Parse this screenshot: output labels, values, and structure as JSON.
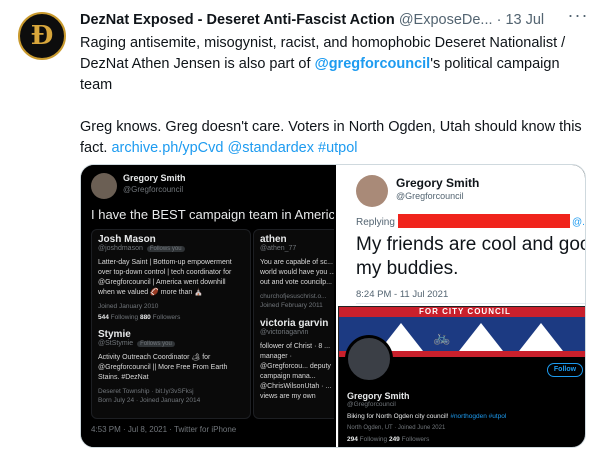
{
  "tweet": {
    "author_name": "DezNat Exposed - Deseret Anti-Fascist Action",
    "author_handle": "@ExposeDe...",
    "separator": "·",
    "date": "13 Jul",
    "more_icon": "ellipsis-icon",
    "avatar_icon": "deseret-d-logo-icon",
    "avatar_glyph": "Ð",
    "text_line1_part1": "Raging antisemite, misogynist, racist, and homophobic Deseret Nationalist / DezNat Athen Jensen is also part of ",
    "text_mention": "@gregforcouncil",
    "text_line1_part2": "'s political campaign team",
    "text_line2": "Greg knows. Greg doesn't care. Voters in North Ogden, Utah should know this fact. ",
    "text_link": "archive.ph/ypCvd",
    "text_link_mention": "@standardex",
    "text_hashtag": "#utpol",
    "link_color": "#1d9bf0"
  },
  "media_left": {
    "name": "Gregory Smith",
    "handle": "@Gregforcouncil",
    "headline": "I have the BEST campaign team in America",
    "card1": {
      "name": "Josh Mason",
      "handle": "@joshdmason",
      "follows_badge": "Follows you",
      "bio": "Latter-day Saint | Bottom-up empowerment over top-down control | tech coordinator for @Gregforcouncil | America went downhill when we valued 🏈 more than ⛪",
      "joined": "Joined January 2010",
      "following": "544",
      "following_label": "Following",
      "followers": "880",
      "followers_label": "Followers"
    },
    "card2": {
      "name": "Stymie",
      "handle": "@StStymie",
      "follows_badge": "Follows you",
      "bio": "Activity Outreach Coordinator 🏕 for @Gregforcouncil || More Free From Earth Stains. #DezNat",
      "location": "Deseret Township",
      "link": "bit.ly/3vSFksj",
      "born": "Born July 24",
      "joined": "Joined January 2014"
    },
    "card3": {
      "name": "athen",
      "handle": "@athen_77",
      "follows_badge": "Follows you",
      "bio": "You are capable of sc... world would have you ... out and vote councilp...",
      "site": "churchofjesuschrist.o...",
      "joined": "Joined February 2011"
    },
    "card4": {
      "name": "victoria garvin",
      "handle": "@victoriagarvin",
      "follows_badge": "Follows",
      "bio": "follower of Christ · 8 ... manager · @Gregforcou... deputy campaign mana... @ChrisWilsonUtah · ... views are my own"
    },
    "footer": "4:53 PM · Jul 8, 2021 · Twitter for iPhone"
  },
  "media_right": {
    "name": "Gregory Smith",
    "handle": "@Gregforcouncil",
    "replying_to": "Replying to",
    "replying_tail": "@...",
    "text_line1": "My friends are cool and goo",
    "text_line2": "my buddies.",
    "time": "8:24 PM - 11 Jul 2021",
    "redaction_color": "#f0241c",
    "profile": {
      "banner_text": "FOR CITY COUNCIL",
      "bike_icon": "bicycle-icon",
      "follow_label": "Follow",
      "name": "Gregory Smith",
      "handle": "@Gregforcouncil",
      "bio_text": "Biking for North Ogden city council! ",
      "bio_tags": "#northogden #utpol",
      "location": "North Ogden, UT",
      "joined": "Joined June 2021",
      "following": "294",
      "following_label": "Following",
      "followers": "249",
      "followers_label": "Followers"
    }
  }
}
